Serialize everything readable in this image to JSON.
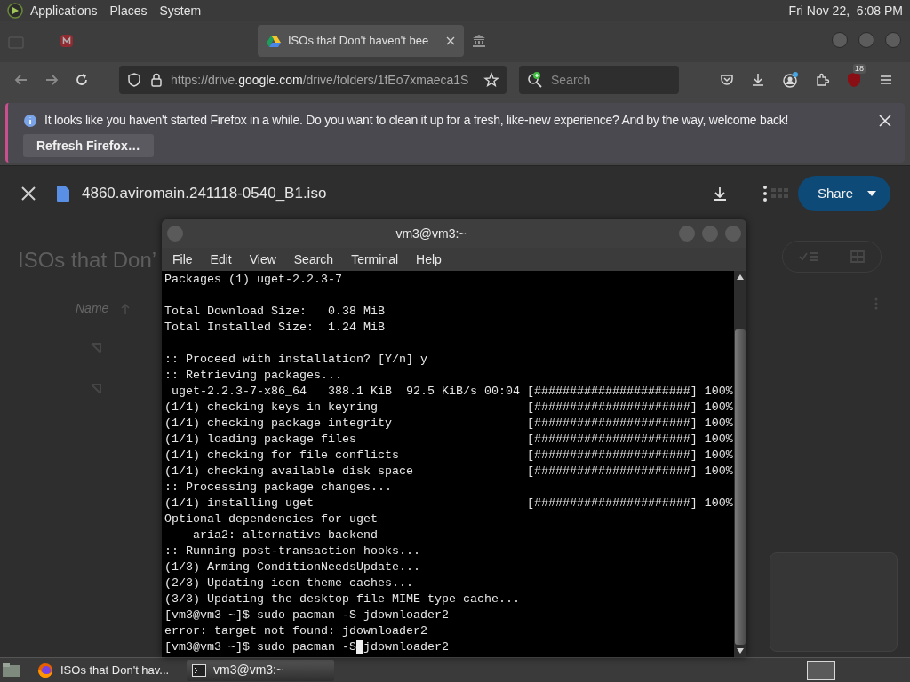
{
  "top_panel": {
    "menus": [
      "Applications",
      "Places",
      "System"
    ],
    "clock": "Fri Nov 22,  6:08 PM"
  },
  "browser": {
    "tabs": [
      {
        "kind": "mail",
        "selected": false
      },
      {
        "kind": "drive",
        "title": "ISOs that Don't haven't bee",
        "selected": true
      },
      {
        "kind": "bank",
        "selected": false
      }
    ],
    "url": {
      "prefix": "https://drive.",
      "domain": "google.com",
      "path": "/drive/folders/1fEo7xmaeca1S"
    },
    "search": {
      "placeholder": "Search"
    },
    "extension_badge": "18",
    "notification": {
      "message": "It looks like you haven't started Firefox in a while. Do you want to clean it up for a fresh, like-new experience? And by the way, welcome back!",
      "button": "Refresh Firefox…"
    }
  },
  "preview": {
    "file_name": "4860.aviromain.241118-0540_B1.iso",
    "share_button": "Share"
  },
  "drive_page": {
    "heading": "ISOs that Don’",
    "column": "Name"
  },
  "terminal": {
    "title": "vm3@vm3:~",
    "menus": [
      "File",
      "Edit",
      "View",
      "Search",
      "Terminal",
      "Help"
    ],
    "lines": [
      {
        "kind": "text",
        "text": "Packages (1) uget-2.2.3-7"
      },
      {
        "kind": "blank"
      },
      {
        "kind": "text",
        "text": "Total Download Size:   0.38 MiB"
      },
      {
        "kind": "text",
        "text": "Total Installed Size:  1.24 MiB"
      },
      {
        "kind": "blank"
      },
      {
        "kind": "text",
        "text": ":: Proceed with installation? [Y/n] y"
      },
      {
        "kind": "text",
        "text": ":: Retrieving packages..."
      },
      {
        "kind": "text",
        "text": " uget-2.2.3-7-x86_64   388.1 KiB  92.5 KiB/s 00:04 [######################] 100%"
      },
      {
        "kind": "text",
        "text": "(1/1) checking keys in keyring                     [######################] 100%"
      },
      {
        "kind": "text",
        "text": "(1/1) checking package integrity                   [######################] 100%"
      },
      {
        "kind": "text",
        "text": "(1/1) loading package files                        [######################] 100%"
      },
      {
        "kind": "text",
        "text": "(1/1) checking for file conflicts                  [######################] 100%"
      },
      {
        "kind": "text",
        "text": "(1/1) checking available disk space                [######################] 100%"
      },
      {
        "kind": "text",
        "text": ":: Processing package changes..."
      },
      {
        "kind": "text",
        "text": "(1/1) installing uget                              [######################] 100%"
      },
      {
        "kind": "text",
        "text": "Optional dependencies for uget"
      },
      {
        "kind": "text",
        "text": "    aria2: alternative backend"
      },
      {
        "kind": "text",
        "text": ":: Running post-transaction hooks..."
      },
      {
        "kind": "text",
        "text": "(1/3) Arming ConditionNeedsUpdate..."
      },
      {
        "kind": "text",
        "text": "(2/3) Updating icon theme caches..."
      },
      {
        "kind": "text",
        "text": "(3/3) Updating the desktop file MIME type cache..."
      },
      {
        "kind": "text",
        "text": "[vm3@vm3 ~]$ sudo pacman -S jdownloader2"
      },
      {
        "kind": "text",
        "text": "error: target not found: jdownloader2"
      },
      {
        "kind": "input",
        "before_cursor": "[vm3@vm3 ~]$ sudo pacman -S",
        "after_cursor": "jdownloader2"
      }
    ]
  },
  "taskbar": {
    "tasks": [
      {
        "kind": "firefox",
        "label": "ISOs that Don't hav...",
        "selected": false
      },
      {
        "kind": "terminal",
        "label": "vm3@vm3:~",
        "selected": true
      }
    ]
  }
}
